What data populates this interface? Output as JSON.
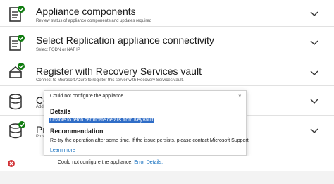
{
  "steps": [
    {
      "title": "Appliance components",
      "subtitle": "Review status of appliance components and updates required",
      "icon": "checklist-check-icon"
    },
    {
      "title": "Select Replication appliance connectivity",
      "subtitle": "Select FQDN or NAT IP",
      "icon": "checklist-check-icon"
    },
    {
      "title": "Register with Recovery Services vault",
      "subtitle": "Connect to Microsoft Azure to register this server with Recovery Services vault.",
      "icon": "vault-check-icon"
    },
    {
      "title": "Co",
      "subtitle": "Add",
      "icon": "database-icon"
    },
    {
      "title": "Pro",
      "subtitle": "Prov",
      "icon": "database-check-icon"
    }
  ],
  "popup": {
    "header": "Could not configure the appliance.",
    "close": "×",
    "details_heading": "Details",
    "details_text": "Unable to fetch certificate details from KeyVault",
    "recommendation_heading": "Recommendation",
    "recommendation_text": "Re-try the operation after some time. If the issue persists, please contact Microsoft Support.",
    "learn_more": "Learn more"
  },
  "status": {
    "message": "Could not configure the appliance.",
    "link": "Error Details."
  },
  "colors": {
    "success": "#107c10",
    "error": "#d13438",
    "link": "#0f6cbd",
    "highlight": "#2f6dc7"
  }
}
